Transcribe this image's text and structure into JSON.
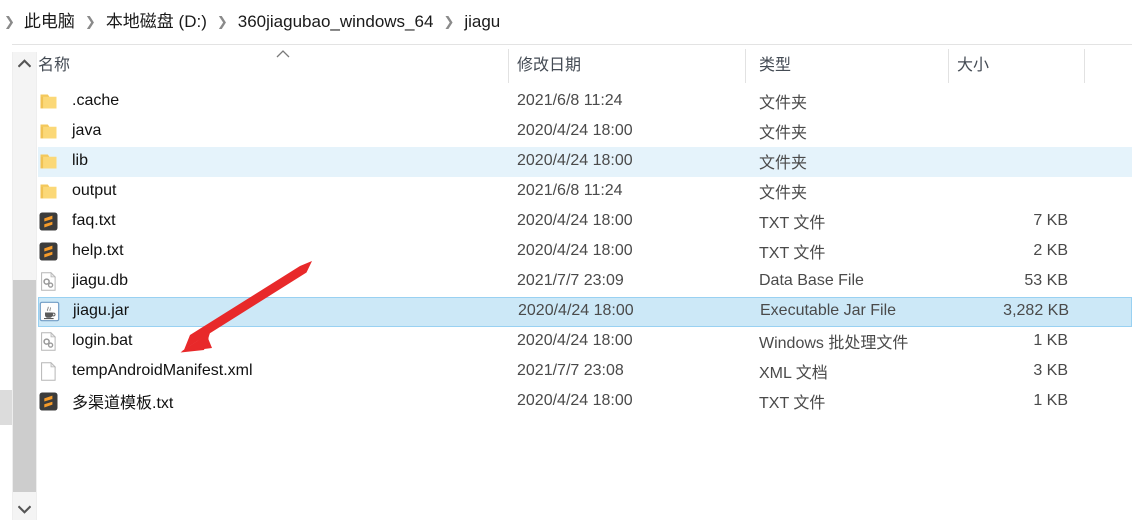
{
  "window": {
    "type": "file-explorer",
    "colors": {
      "selection_fill": "#cce8f7",
      "selection_border": "#99d1f2",
      "hover_fill": "#e5f3fb",
      "header_text": "#444b54",
      "annotation_arrow": "#e8292a",
      "folder_icon": "#fbd877",
      "sublime_icon_bg": "#3c3c3c",
      "sublime_icon_fg": "#f79c2a"
    }
  },
  "breadcrumb": {
    "leading_separator": "❯",
    "separator": "❯",
    "items": [
      {
        "label": "此电脑"
      },
      {
        "label": "本地磁盘 (D:)"
      },
      {
        "label": "360jiagubao_windows_64"
      },
      {
        "label": "jiagu"
      }
    ]
  },
  "columns": {
    "name": "名称",
    "date": "修改日期",
    "type": "类型",
    "size": "大小",
    "sort_column": "名称",
    "sort_direction": "ascending"
  },
  "files": [
    {
      "name": ".cache",
      "date": "2021/6/8 11:24",
      "type": "文件夹",
      "size": "",
      "icon": "folder-icon",
      "state": "normal"
    },
    {
      "name": "java",
      "date": "2020/4/24 18:00",
      "type": "文件夹",
      "size": "",
      "icon": "folder-icon",
      "state": "normal"
    },
    {
      "name": "lib",
      "date": "2020/4/24 18:00",
      "type": "文件夹",
      "size": "",
      "icon": "folder-icon",
      "state": "hover"
    },
    {
      "name": "output",
      "date": "2021/6/8 11:24",
      "type": "文件夹",
      "size": "",
      "icon": "folder-icon",
      "state": "normal"
    },
    {
      "name": "faq.txt",
      "date": "2020/4/24 18:00",
      "type": "TXT 文件",
      "size": "7 KB",
      "icon": "sublime-text-icon",
      "state": "normal"
    },
    {
      "name": "help.txt",
      "date": "2020/4/24 18:00",
      "type": "TXT 文件",
      "size": "2 KB",
      "icon": "sublime-text-icon",
      "state": "normal"
    },
    {
      "name": "jiagu.db",
      "date": "2021/7/7 23:09",
      "type": "Data Base File",
      "size": "53 KB",
      "icon": "generic-gears-file-icon",
      "state": "normal"
    },
    {
      "name": "jiagu.jar",
      "date": "2020/4/24 18:00",
      "type": "Executable Jar File",
      "size": "3,282 KB",
      "icon": "java-jar-icon",
      "state": "selected"
    },
    {
      "name": "login.bat",
      "date": "2020/4/24 18:00",
      "type": "Windows 批处理文件",
      "size": "1 KB",
      "icon": "generic-gears-file-icon",
      "state": "normal"
    },
    {
      "name": "tempAndroidManifest.xml",
      "date": "2021/7/7 23:08",
      "type": "XML 文档",
      "size": "3 KB",
      "icon": "blank-document-icon",
      "state": "normal"
    },
    {
      "name": "多渠道模板.txt",
      "date": "2020/4/24 18:00",
      "type": "TXT 文件",
      "size": "1 KB",
      "icon": "sublime-text-icon",
      "state": "normal"
    }
  ],
  "scrollbar": {
    "position": "left",
    "up_arrow": "chevron-up-icon",
    "down_arrow": "chevron-down-icon"
  },
  "annotation": {
    "shape": "arrow",
    "points_to": "jiagu.jar",
    "color": "#e8292a"
  }
}
